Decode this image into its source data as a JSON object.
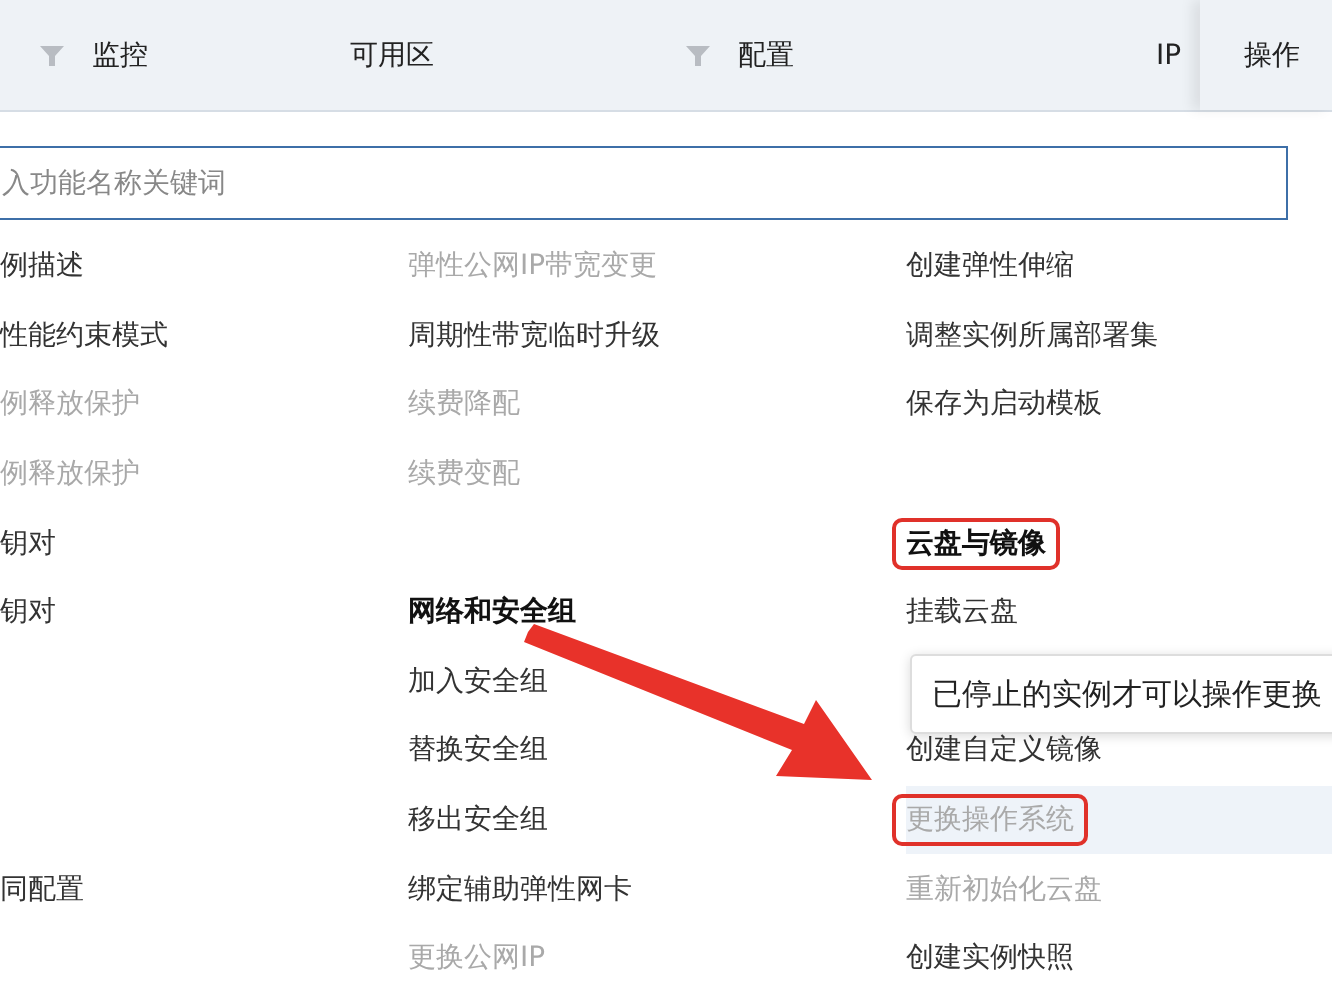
{
  "table_header": {
    "columns": [
      {
        "label": "监控",
        "filter": true
      },
      {
        "label": "可用区",
        "filter": false
      },
      {
        "label": "配置",
        "filter": true
      },
      {
        "label": "IP",
        "filter": false
      }
    ],
    "action_column": "操作"
  },
  "menu": {
    "search": {
      "placeholder": "入功能名称关键词"
    },
    "columns": [
      [
        {
          "kind": "item",
          "label": "例描述",
          "disabled": false
        },
        {
          "kind": "item",
          "label": "性能约束模式",
          "disabled": false
        },
        {
          "kind": "item",
          "label": "例释放保护",
          "disabled": true
        },
        {
          "kind": "item",
          "label": "例释放保护",
          "disabled": true
        },
        {
          "kind": "item",
          "label": "钥对",
          "disabled": false
        },
        {
          "kind": "item",
          "label": "钥对",
          "disabled": false
        },
        {
          "kind": "spacer"
        },
        {
          "kind": "spacer"
        },
        {
          "kind": "spacer"
        },
        {
          "kind": "item",
          "label": "同配置",
          "disabled": false
        }
      ],
      [
        {
          "kind": "item",
          "label": "弹性公网IP带宽变更",
          "disabled": true
        },
        {
          "kind": "item",
          "label": "周期性带宽临时升级",
          "disabled": false
        },
        {
          "kind": "item",
          "label": "续费降配",
          "disabled": true
        },
        {
          "kind": "item",
          "label": "续费变配",
          "disabled": true
        },
        {
          "kind": "spacer"
        },
        {
          "kind": "header",
          "label": "网络和安全组",
          "highlighted": false
        },
        {
          "kind": "item",
          "label": "加入安全组",
          "disabled": false
        },
        {
          "kind": "item",
          "label": "替换安全组",
          "disabled": false
        },
        {
          "kind": "item",
          "label": "移出安全组",
          "disabled": false
        },
        {
          "kind": "item",
          "label": "绑定辅助弹性网卡",
          "disabled": false
        },
        {
          "kind": "item",
          "label": "更换公网IP",
          "disabled": true
        }
      ],
      [
        {
          "kind": "item",
          "label": "创建弹性伸缩",
          "disabled": false
        },
        {
          "kind": "item",
          "label": "调整实例所属部署集",
          "disabled": false
        },
        {
          "kind": "item",
          "label": "保存为启动模板",
          "disabled": false
        },
        {
          "kind": "spacer"
        },
        {
          "kind": "header",
          "label": "云盘与镜像",
          "highlighted": true
        },
        {
          "kind": "item",
          "label": "挂载云盘",
          "disabled": false
        },
        {
          "kind": "spacer"
        },
        {
          "kind": "item",
          "label": "创建自定义镜像",
          "disabled": false
        },
        {
          "kind": "item",
          "label": "更换操作系统",
          "disabled": true,
          "highlighted": true,
          "hovered": true
        },
        {
          "kind": "item",
          "label": "重新初始化云盘",
          "disabled": true
        },
        {
          "kind": "item",
          "label": "创建实例快照",
          "disabled": false
        }
      ]
    ]
  },
  "tooltip": {
    "text": "已停止的实例才可以操作更换"
  }
}
